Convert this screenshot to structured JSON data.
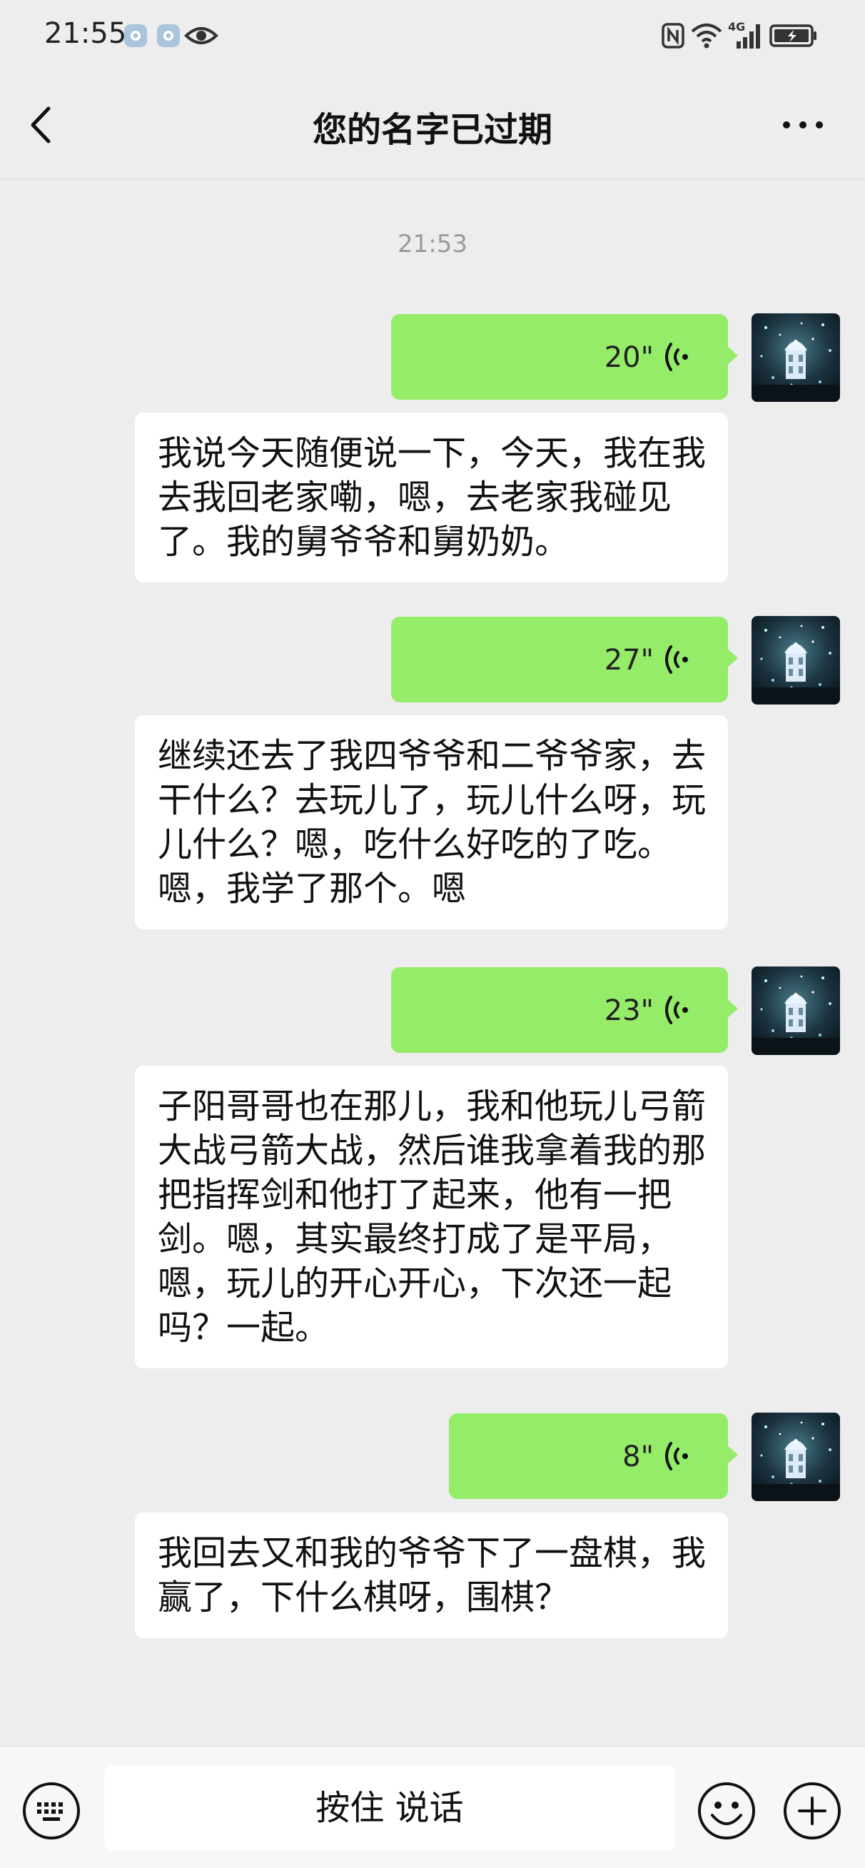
{
  "status_bar": {
    "time": "21:55",
    "icons": [
      "app-notification-icon",
      "app-notification-icon",
      "eye-icon",
      "nfc-icon",
      "wifi-icon",
      "signal-4g-icon",
      "battery-charging-icon"
    ],
    "network_label": "4G"
  },
  "nav": {
    "title": "您的名字已过期",
    "back_icon": "chevron-left-icon",
    "more_icon": "more-dots-icon"
  },
  "chat": {
    "timestamp": "21:53",
    "messages": [
      {
        "voice_duration": "20\"",
        "transcript": "我说今天随便说一下，今天，我在我去我回老家嘞，嗯，去老家我碰见了。我的舅爷爷和舅奶奶。"
      },
      {
        "voice_duration": "27\"",
        "transcript": "继续还去了我四爷爷和二爷爷家，去干什么？去玩儿了，玩儿什么呀，玩儿什么？嗯，吃什么好吃的了吃。嗯，我学了那个。嗯"
      },
      {
        "voice_duration": "23\"",
        "transcript": "子阳哥哥也在那儿，我和他玩儿弓箭大战弓箭大战，然后谁我拿着我的那把指挥剑和他打了起来，他有一把剑。嗯，其实最终打成了是平局，嗯，玩儿的开心开心，下次还一起吗？一起。"
      },
      {
        "voice_duration": "8\"",
        "transcript": "我回去又和我的爷爷下了一盘棋，我赢了，下什么棋呀，围棋？"
      }
    ]
  },
  "input_bar": {
    "hold_to_talk_label": "按住 说话",
    "keyboard_icon": "keyboard-icon",
    "emoji_icon": "emoji-icon",
    "plus_icon": "plus-icon"
  },
  "colors": {
    "background": "#ededed",
    "voice_bubble": "#95ec69",
    "text_bubble": "#ffffff"
  }
}
